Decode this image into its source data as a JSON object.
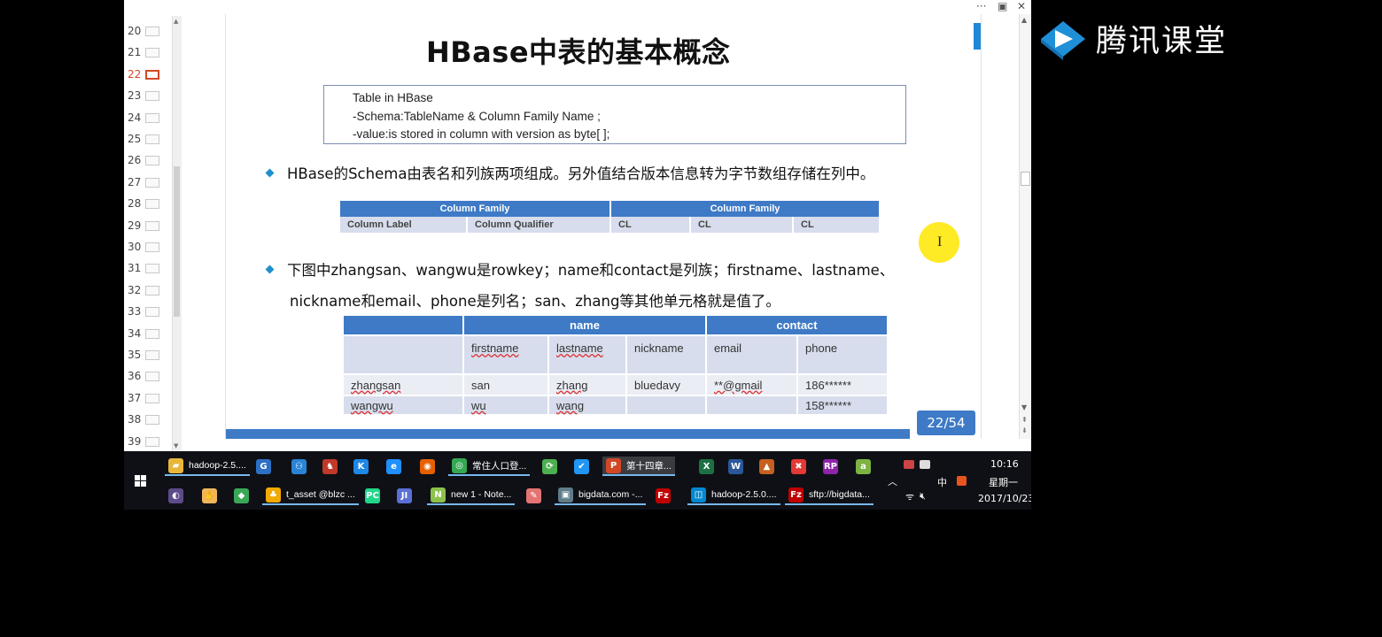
{
  "slide_panel": {
    "numbers": [
      "20",
      "21",
      "22",
      "23",
      "24",
      "25",
      "26",
      "27",
      "28",
      "29",
      "30",
      "31",
      "32",
      "33",
      "34",
      "35",
      "36",
      "37",
      "38",
      "39"
    ],
    "active": "22"
  },
  "slide": {
    "title": "HBase中表的基本概念",
    "code_lines": [
      "Table in HBase",
      "-Schema:TableName & Column Family Name ;",
      "-value:is stored in column with version as byte[ ];"
    ],
    "bullet1": "HBase的Schema由表名和列族两项组成。另外值结合版本信息转为字节数组存储在列中。",
    "schema_table": {
      "header": [
        "Column Family",
        "Column Family"
      ],
      "row": [
        "Column Label",
        "Column Qualifier",
        "CL",
        "CL",
        "CL"
      ]
    },
    "bullet2_line1": "下图中zhangsan、wangwu是rowkey；name和contact是列族；firstname、lastname、",
    "bullet2_line2": "nickname和email、phone是列名；san、zhang等其他单元格就是值了。",
    "rowkey_table": {
      "families": [
        "",
        "name",
        "contact"
      ],
      "columns": [
        "",
        "firstname",
        "lastname",
        "nickname",
        "email",
        "phone"
      ],
      "rows": [
        [
          "zhangsan",
          "san",
          "zhang",
          "bluedavy",
          "**@gmail",
          "186******"
        ],
        [
          "wangwu",
          "wu",
          "wang",
          "",
          "",
          "158******"
        ]
      ]
    },
    "page": "22/54"
  },
  "window_controls": [
    "···",
    "▣",
    "✕"
  ],
  "taskbar": {
    "row1": [
      {
        "label": "hadoop-2.5....",
        "icon": "folder-icon",
        "color": "#e8b73a"
      },
      {
        "label": "",
        "icon": "g-app-icon",
        "color": "#2d6fc4"
      },
      {
        "label": "",
        "icon": "network-icon",
        "color": "#2a84d6"
      },
      {
        "label": "",
        "icon": "bird-icon",
        "color": "#c0392b"
      },
      {
        "label": "",
        "icon": "k-app-icon",
        "color": "#1e88e5"
      },
      {
        "label": "",
        "icon": "ie-icon",
        "color": "#1e90ff"
      },
      {
        "label": "",
        "icon": "firefox-icon",
        "color": "#e66000"
      },
      {
        "label": "常住人口登...",
        "icon": "chrome-icon",
        "color": "#34a853"
      },
      {
        "label": "",
        "icon": "refresh-app-icon",
        "color": "#4caf50"
      },
      {
        "label": "",
        "icon": "checkmark-app-icon",
        "color": "#2196f3"
      },
      {
        "label": "第十四章...",
        "icon": "powerpoint-icon",
        "color": "#d24726"
      },
      {
        "label": "",
        "icon": "excel-icon",
        "color": "#1d7044"
      },
      {
        "label": "",
        "icon": "word-icon",
        "color": "#2b579a"
      },
      {
        "label": "",
        "icon": "matlab-icon",
        "color": "#c65f20"
      },
      {
        "label": "",
        "icon": "xmind-icon",
        "color": "#e53935"
      },
      {
        "label": "",
        "icon": "axure-icon",
        "color": "#8e24aa"
      },
      {
        "label": "",
        "icon": "circle-app-icon",
        "color": "#7cb342"
      }
    ],
    "row2": [
      {
        "label": "",
        "icon": "eclipse-icon",
        "color": "#5c4b8a"
      },
      {
        "label": "",
        "icon": "hand-icon",
        "color": "#f0b65a"
      },
      {
        "label": "",
        "icon": "cube-icon",
        "color": "#3aa757"
      },
      {
        "label": "t_asset @blzc ...",
        "icon": "navicat-icon",
        "color": "#f2a900"
      },
      {
        "label": "",
        "icon": "pycharm-icon",
        "color": "#21d789"
      },
      {
        "label": "",
        "icon": "jetbrains-icon",
        "color": "#5b6fd6"
      },
      {
        "label": "new  1 - Note...",
        "icon": "notepad-icon",
        "color": "#8bc34a"
      },
      {
        "label": "",
        "icon": "pencil-icon",
        "color": "#e57373"
      },
      {
        "label": "bigdata.com -...",
        "icon": "terminal-icon",
        "color": "#607d8b"
      },
      {
        "label": "",
        "icon": "filezilla-icon",
        "color": "#bf0000"
      },
      {
        "label": "hadoop-2.5.0....",
        "icon": "app-window-icon",
        "color": "#0288d1"
      },
      {
        "label": "sftp://bigdata...",
        "icon": "filezilla-icon",
        "color": "#bf0000"
      }
    ],
    "tray": {
      "ime": "中",
      "time": "10:16",
      "weekday": "星期一",
      "date": "2017/10/23"
    }
  },
  "overlay_logo": "腾讯课堂"
}
